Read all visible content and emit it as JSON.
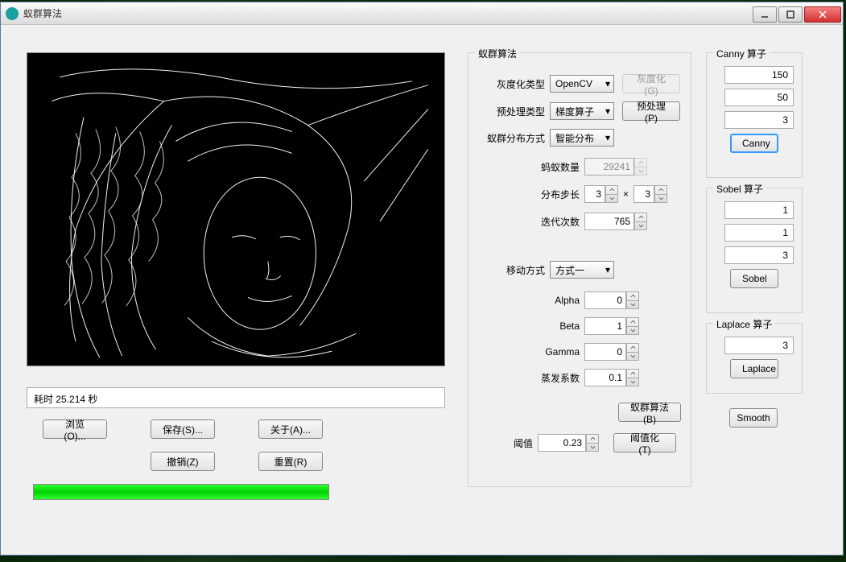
{
  "title": "蚁群算法",
  "status": "耗时 25.214 秒",
  "buttons": {
    "browse": "浏览(O)...",
    "save": "保存(S)...",
    "about": "关于(A)...",
    "undo": "撤销(Z)",
    "reset": "重置(R)",
    "smooth": "Smooth"
  },
  "ant": {
    "legend": "蚁群算法",
    "gray": {
      "label": "灰度化类型",
      "value": "OpenCV",
      "btn": "灰度化(G)"
    },
    "preproc": {
      "label": "预处理类型",
      "value": "梯度算子",
      "btn": "预处理(P)"
    },
    "dist": {
      "label": "蚁群分布方式",
      "value": "智能分布"
    },
    "count": {
      "label": "蚂蚁数量",
      "value": "29241"
    },
    "step": {
      "label": "分布步长",
      "a": "3",
      "b": "3",
      "x": "×"
    },
    "iter": {
      "label": "迭代次数",
      "value": "765"
    },
    "move": {
      "label": "移动方式",
      "value": "方式一"
    },
    "alpha": {
      "label": "Alpha",
      "value": "0"
    },
    "beta": {
      "label": "Beta",
      "value": "1"
    },
    "gamma": {
      "label": "Gamma",
      "value": "0"
    },
    "evap": {
      "label": "蒸发系数",
      "value": "0.1"
    },
    "run_btn": "蚁群算法(B)",
    "thresh": {
      "label": "阈值",
      "value": "0.23",
      "btn": "阈值化(T)"
    }
  },
  "canny": {
    "legend": "Canny 算子",
    "v1": "150",
    "v2": "50",
    "v3": "3",
    "btn": "Canny"
  },
  "sobel": {
    "legend": "Sobel 算子",
    "v1": "1",
    "v2": "1",
    "v3": "3",
    "btn": "Sobel"
  },
  "laplace": {
    "legend": "Laplace 算子",
    "v1": "3",
    "btn": "Laplace"
  }
}
